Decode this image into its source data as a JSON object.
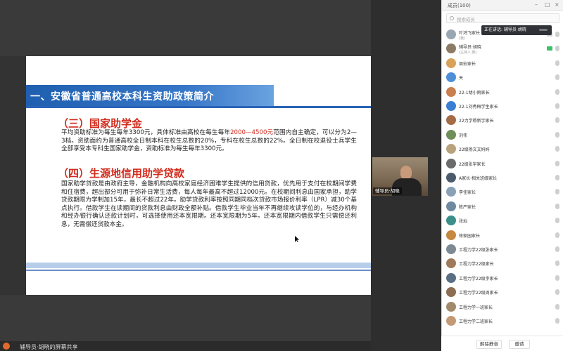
{
  "slide": {
    "banner_title": "一、安徽省普通高校本科生资助政策简介",
    "section3_title": "（三）国家助学金",
    "section3_text_a": "平均资助标准为每生每年3300元，具体标准由高校在每生每年",
    "section3_text_red": "2000—4500元",
    "section3_text_b": "范围内自主确定，可以分为2—3档。资助面约为普通高校全日制本科在校生总数的20%，专科在校生总数的22%。全日制在校退役士兵学生全部享受本专科生国家助学金，资助标准为每生每年3300元。",
    "section4_title": "（四）生源地信用助学贷款",
    "section4_text": "国家助学贷款是由政府主导，金融机构向高校家庭经济困难学生提供的信用贷款，优先用于支付在校期间学费和住宿费，超出部分可用于弥补日常生活费，每人每年最高不超过12000元。在校期间利息由国家承担，助学贷款期限为学制加15年，最长不超过22年。助学贷款利率按照同期同档次贷款市场报价利率（LPR）减30个基点执行。借款学生在读期间的贷款利息由财政全额补贴。借款学生毕业当年不再继续攻读学位的，与经办机构和经办银行确认还款计划时，可选择使用还本宽限期。还本宽限期为5年。还本宽限期内借款学生只需偿还利息，无需偿还贷款本金。"
  },
  "bottom_bar": {
    "sharer_text": "辅导员·胡晓的屏幕共享"
  },
  "video": {
    "label": "辅导员·胡晓"
  },
  "panel": {
    "title": "成员(100)",
    "search_placeholder": "搜索成员",
    "tooltip": "正在讲话: 辅导员·胡晓",
    "participants": [
      {
        "name": "叶鸿飞家长",
        "sub": "(我)",
        "color": "#9aa7b3"
      },
      {
        "name": "辅导员·胡晓",
        "sub": "(主持人,我)",
        "color": "#8d7a64"
      },
      {
        "name": "周宏家长",
        "sub": "",
        "color": "#d9a25a"
      },
      {
        "name": "天",
        "sub": "",
        "color": "#4e8fd8"
      },
      {
        "name": "22-1胡小雨家长",
        "sub": "",
        "color": "#c9804e"
      },
      {
        "name": "22-1刘秀梅学生家长",
        "sub": "",
        "color": "#3a7fd1"
      },
      {
        "name": "22力学杨新宇家长",
        "sub": "",
        "color": "#a56b45"
      },
      {
        "name": "刘伟",
        "sub": "",
        "color": "#6e8e5a"
      },
      {
        "name": "22级杨文文妈妈",
        "sub": "",
        "color": "#b8a27c"
      },
      {
        "name": "22级张宇家长",
        "sub": "",
        "color": "#6a6a6a"
      },
      {
        "name": "A家长·相关班级家长",
        "sub": "",
        "color": "#4b5b6b"
      },
      {
        "name": "李佳家长",
        "sub": "",
        "color": "#8aa0b6"
      },
      {
        "name": "陈严家长",
        "sub": "",
        "color": "#6f8aa0"
      },
      {
        "name": "张灿",
        "sub": "",
        "color": "#3b8f8a"
      },
      {
        "name": "徐家园家长",
        "sub": "",
        "color": "#c6873f"
      },
      {
        "name": "工程力学22级张家长",
        "sub": "",
        "color": "#7c8a96"
      },
      {
        "name": "工程力学22级家长",
        "sub": "",
        "color": "#9e7a5a"
      },
      {
        "name": "工程力学22级李家长",
        "sub": "",
        "color": "#5b6f84"
      },
      {
        "name": "工程力学22级周家长",
        "sub": "",
        "color": "#8d6e52"
      },
      {
        "name": "工程力学一班家长",
        "sub": "",
        "color": "#a38a6a"
      },
      {
        "name": "工程力学二班家长",
        "sub": "",
        "color": "#c49a76"
      }
    ],
    "footer_btn_1": "解除静音",
    "footer_btn_2": "邀请"
  },
  "colors": {
    "accent_blue": "#2a64b6",
    "heading_red": "#d22a1c",
    "mic_on_green": "#3ec06a"
  }
}
